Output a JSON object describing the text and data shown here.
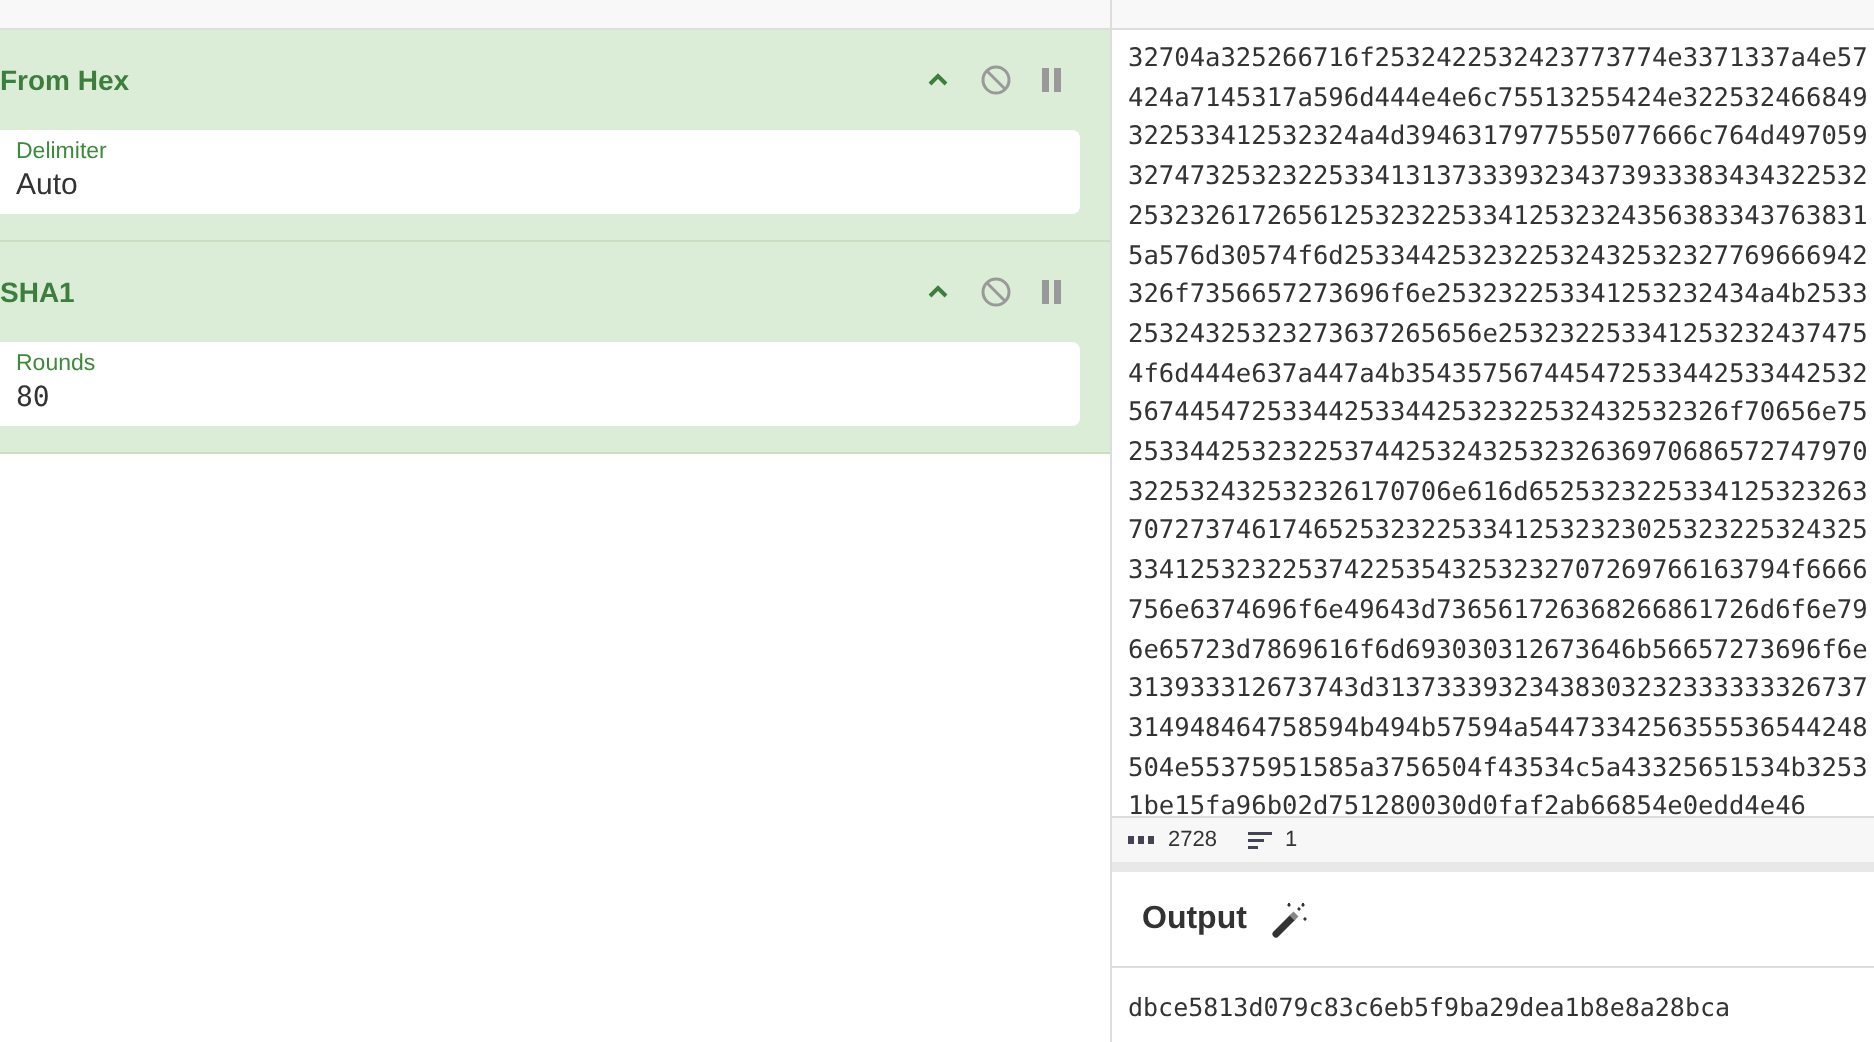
{
  "recipe": [
    {
      "title": "From Hex",
      "field": {
        "label": "Delimiter",
        "value": "Auto",
        "kind": "text"
      }
    },
    {
      "title": "SHA1",
      "field": {
        "label": "Rounds",
        "value": "80",
        "kind": "number"
      }
    }
  ],
  "input": {
    "lines": [
      "32704a325266716f2532422532423773774e3371337a4e57",
      "424a7145317a596d444e4e6c75513255424e322532466849",
      "322533412532324a4d3946317977555077666c764d497059",
      "327473253232253341313733393234373933383434322532",
      "253232617265612532322533412532324356383343763831",
      "5a576d30574f6d2533442532322532432532327769666942",
      "326f7356657273696f6e253232253341253232434a4b2533",
      "25324325323273637265656e253232253341253232437475",
      "4f6d444e637a447a4b354357567445472533442533442532",
      "567445472533442533442532322532432532326f70656e75",
      "253344253232253744253243253232636970686572747970",
      "322532432532326170706e616d6525323225334125323263",
      "707273746174652532322533412532323025323225324325",
      "3341253232253742253543253232707269766163794f6666",
      "756e6374696f6e49643d736561726368266861726d6f6e79",
      "6e65723d7869616f6d693030312673646b56657273696f6e",
      "313933312673743d31373339323438303232333333326737",
      "314948464758594b494b57594a5447334256355536544248",
      "504e55375951585a3756504f43534c5a43325651534b3253",
      "1be15fa96b02d751280030d0faf2ab66854e0edd4e46"
    ]
  },
  "status_bar": {
    "length": "2728",
    "lines": "1"
  },
  "output": {
    "title": "Output",
    "value": "dbce5813d079c83c6eb5f9ba29dea1b8e8a28bca"
  }
}
